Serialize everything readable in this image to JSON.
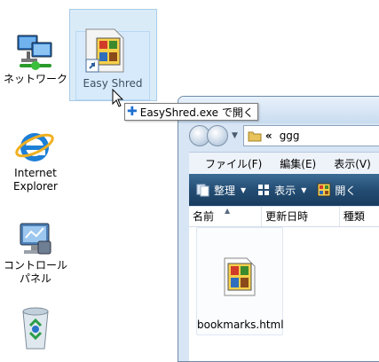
{
  "desktop": {
    "icons": [
      {
        "label": "ネットワーク"
      },
      {
        "label": "Internet",
        "label2": "Explorer"
      },
      {
        "label": "コントロール",
        "label2": "パネル"
      },
      {
        "label": ""
      }
    ]
  },
  "drag": {
    "label": "Easy Shred",
    "tooltip": "EasyShred.exe で開く"
  },
  "explorer": {
    "address": "ggg",
    "nav_chevron": "«",
    "menu": [
      "ファイル(F)",
      "編集(E)",
      "表示(V)"
    ],
    "commands": {
      "organize": "整理",
      "view": "表示",
      "open": "開く"
    },
    "columns": [
      "名前",
      "更新日時",
      "種類"
    ],
    "files": [
      {
        "name": "bookmarks.html"
      }
    ]
  },
  "colors": {
    "command_bar": "#244d73",
    "drag_highlight": "#cde4f6",
    "tooltip_plus": "#1f6fd0"
  }
}
